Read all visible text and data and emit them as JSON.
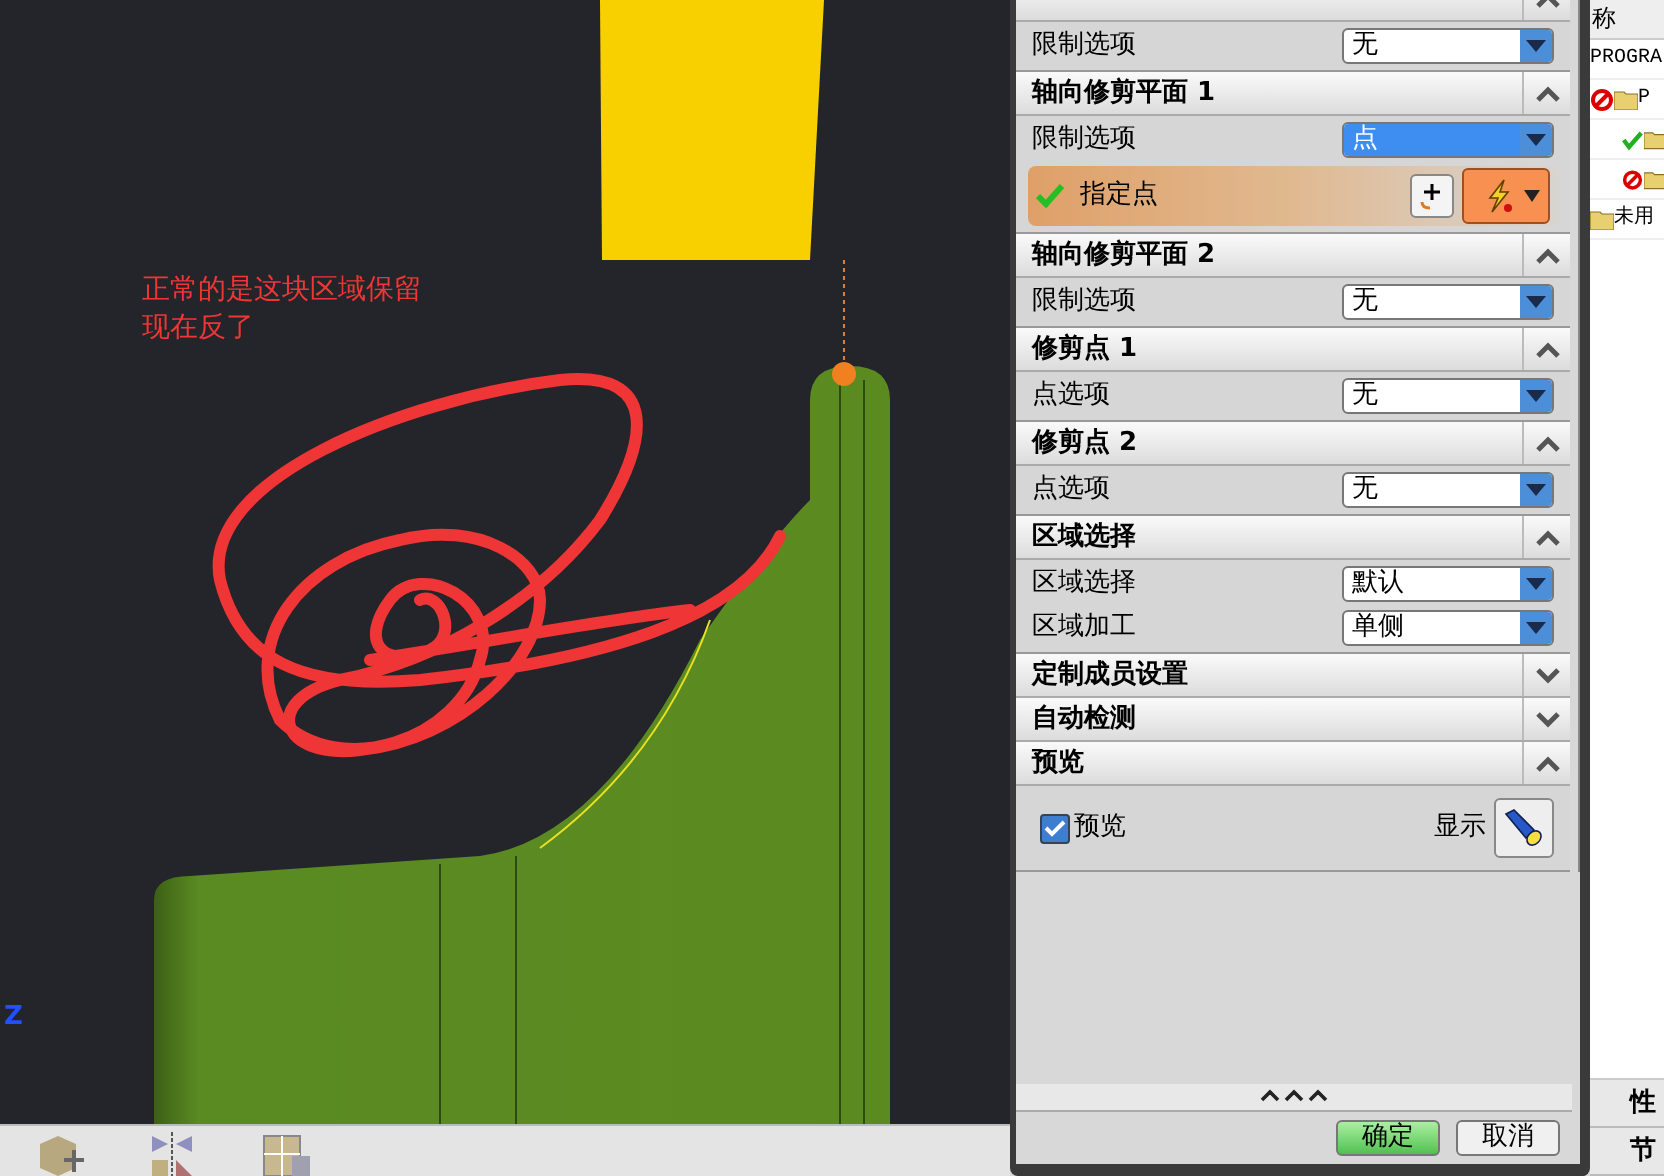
{
  "annotation": {
    "lines": [
      "正常的是这块区域保留",
      "现在反了"
    ]
  },
  "axis_label": "Z",
  "dialog": {
    "sections": [
      {
        "expanded": true,
        "rows": [
          {
            "kind": "select",
            "label": "限制选项",
            "value": "无",
            "focused": false
          }
        ]
      },
      {
        "title": "轴向修剪平面 1",
        "expanded": true,
        "rows": [
          {
            "kind": "select",
            "label": "限制选项",
            "value": "点",
            "focused": true
          },
          {
            "kind": "point",
            "label": "指定点",
            "checked": true
          }
        ]
      },
      {
        "title": "轴向修剪平面 2",
        "expanded": true,
        "rows": [
          {
            "kind": "select",
            "label": "限制选项",
            "value": "无",
            "focused": false
          }
        ]
      },
      {
        "title": "修剪点 1",
        "expanded": true,
        "rows": [
          {
            "kind": "select",
            "label": "点选项",
            "value": "无",
            "focused": false
          }
        ]
      },
      {
        "title": "修剪点 2",
        "expanded": true,
        "rows": [
          {
            "kind": "select",
            "label": "点选项",
            "value": "无",
            "focused": false
          }
        ]
      },
      {
        "title": "区域选择",
        "expanded": true,
        "rows": [
          {
            "kind": "select",
            "label": "区域选择",
            "value": "默认",
            "focused": false
          },
          {
            "kind": "select",
            "label": "区域加工",
            "value": "单侧",
            "focused": false
          }
        ]
      },
      {
        "title": "定制成员设置",
        "expanded": false
      },
      {
        "title": "自动检测",
        "expanded": false
      },
      {
        "title": "预览",
        "expanded": true,
        "rows": [
          {
            "kind": "preview",
            "label": "预览",
            "checked": true,
            "button_label": "显示"
          }
        ]
      }
    ],
    "buttons": [
      {
        "label": "确定",
        "primary": true
      },
      {
        "label": "取消",
        "primary": false
      }
    ]
  },
  "navigator": {
    "header": "称",
    "items": [
      {
        "kind": "plain",
        "label": "PROGRA"
      },
      {
        "kind": "blocked",
        "label": "P",
        "children": [
          {
            "kind": "ok"
          },
          {
            "kind": "blocked"
          }
        ]
      },
      {
        "kind": "folder",
        "label": "未用"
      }
    ],
    "bottom_labels": [
      "性",
      "节"
    ]
  }
}
